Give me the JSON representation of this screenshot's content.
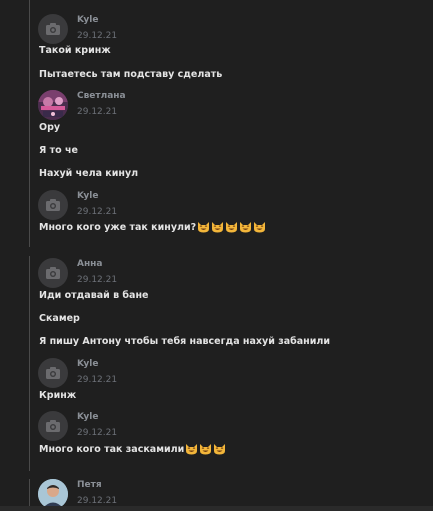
{
  "messages": [
    {
      "author": "Kyle",
      "time": "29.12.21",
      "avatar": "camera-icon",
      "lines": [
        "Такой кринж",
        "Пытаетесь там подставу сделать"
      ]
    },
    {
      "author": "Светлана",
      "time": "29.12.21",
      "avatar": "photo",
      "lines": [
        "Ору",
        "Я то че",
        "Нахуй чела кинул"
      ]
    },
    {
      "author": "Kyle",
      "time": "29.12.21",
      "avatar": "camera-icon",
      "lines": [
        "Много кого уже так кинули?"
      ],
      "emoji_count": 5,
      "emoji": "grinning-cat-smiling-eyes-emoji"
    },
    {
      "author": "Анна",
      "time": "29.12.21",
      "avatar": "camera-icon",
      "lines": [
        "Иди отдавай в бане",
        "Скамер",
        "Я пишу Антону чтобы тебя навсегда нахуй забанили"
      ]
    },
    {
      "author": "Kyle",
      "time": "29.12.21",
      "avatar": "camera-icon",
      "lines": [
        "Кринж"
      ]
    },
    {
      "author": "Kyle",
      "time": "29.12.21",
      "avatar": "camera-icon",
      "lines": [
        "Много кого так заскамили"
      ],
      "emoji_count": 3,
      "emoji": "grinning-cat-smiling-eyes-emoji"
    },
    {
      "author": "Петя",
      "time": "29.12.21",
      "avatar": "photo",
      "lines": []
    }
  ],
  "colors": {
    "background": "#1f1f1f",
    "text": "#e4e4e4",
    "author": "#8a8f96",
    "time": "#6c7077",
    "thread_line": "#4a4a4a"
  }
}
